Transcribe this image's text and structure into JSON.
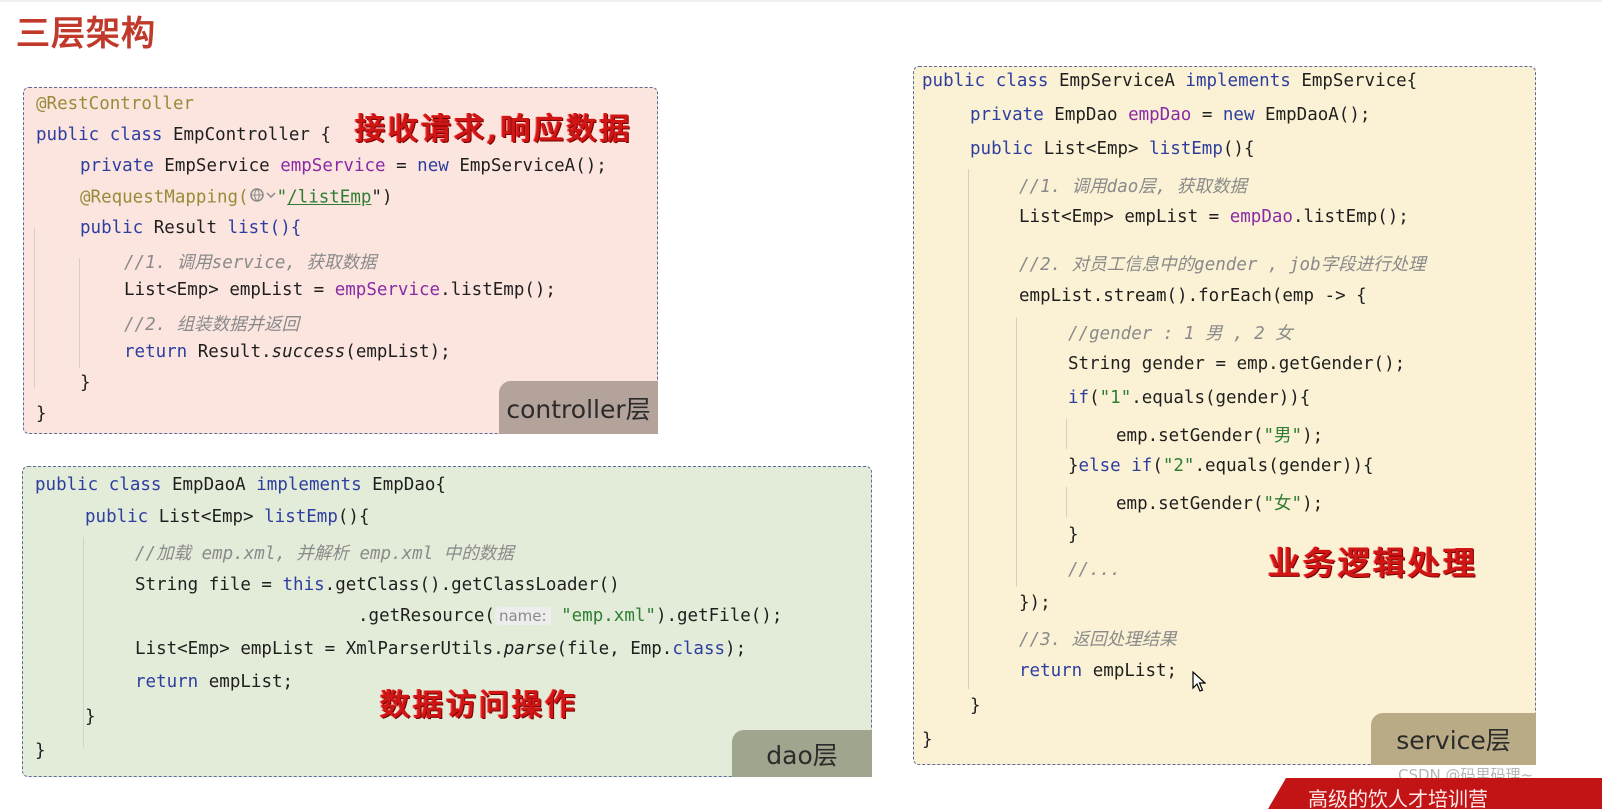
{
  "page": {
    "title": "三层架构"
  },
  "controller": {
    "annotation": "@RestController",
    "l1": {
      "a": "public class ",
      "b": "EmpController {"
    },
    "l2": {
      "a": "private ",
      "b": "EmpService ",
      "c": "empService",
      "d": " = ",
      "e": "new ",
      "f": "EmpServiceA();"
    },
    "l3": {
      "a": "@RequestMapping(",
      "icon": "globe-icon",
      "b": "\"",
      "c": "/listEmp",
      "d": "\")"
    },
    "l4": {
      "a": "public ",
      "b": "Result ",
      "c": "list(){"
    },
    "l5": "//1. 调用service, 获取数据",
    "l6": {
      "a": "List<Emp> empList = ",
      "b": "empService",
      "c": ".listEmp();"
    },
    "l7": "//2. 组装数据并返回",
    "l8": {
      "a": "return ",
      "b": "Result.",
      "c": "success",
      "d": "(empList);"
    },
    "l9": "}",
    "l10": "}",
    "tag": "controller层",
    "note": "接收请求,响应数据"
  },
  "dao": {
    "l1": {
      "a": "public class ",
      "b": "EmpDaoA ",
      "c": "implements ",
      "d": "EmpDao{"
    },
    "l2": {
      "a": "public ",
      "b": "List<Emp> ",
      "c": "listEmp",
      "d": "(){"
    },
    "l3": "//加载 emp.xml, 并解析 emp.xml 中的数据",
    "l4": {
      "a": "String file = ",
      "b": "this",
      "c": ".getClass().getClassLoader()"
    },
    "l5": {
      "a": ".getResource(",
      "hint": "name:",
      "b": "\"emp.xml\"",
      "c": ").getFile();"
    },
    "l6": {
      "a": "List<Emp> empList = XmlParserUtils.",
      "b": "parse",
      "c": "(file, Emp.",
      "d": "class",
      "e": ");"
    },
    "l7": {
      "a": "return ",
      "b": "empList;"
    },
    "l8": "}",
    "l9": "}",
    "tag": "dao层",
    "note": "数据访问操作"
  },
  "service": {
    "l1": {
      "a": "public class ",
      "b": "EmpServiceA ",
      "c": "implements ",
      "d": "EmpService{"
    },
    "l2": {
      "a": "private ",
      "b": "EmpDao ",
      "c": "empDao",
      "d": " = ",
      "e": "new ",
      "f": "EmpDaoA();"
    },
    "l3": {
      "a": "public ",
      "b": "List<Emp> ",
      "c": "listEmp",
      "d": "(){"
    },
    "l4": "//1. 调用dao层, 获取数据",
    "l5": {
      "a": "List<Emp> empList = ",
      "b": "empDao",
      "c": ".listEmp();"
    },
    "l6": "//2. 对员工信息中的gender , job字段进行处理",
    "l7": "empList.stream().forEach(emp -> {",
    "l8": "//gender : 1 男 , 2 女",
    "l9": "String gender = emp.getGender();",
    "l10": {
      "a": "if",
      "b": "(",
      "c": "\"1\"",
      "d": ".equals(gender)){"
    },
    "l11": {
      "a": "emp.setGender(",
      "b": "\"男\"",
      "c": ");"
    },
    "l12": {
      "a": "}",
      "b": "else if",
      "c": "(",
      "d": "\"2\"",
      "e": ".equals(gender)){"
    },
    "l13": {
      "a": "emp.setGender(",
      "b": "\"女\"",
      "c": ");"
    },
    "l14": "}",
    "l15": "//...",
    "l16": "});",
    "l17": "//3. 返回处理结果",
    "l18": {
      "a": "return ",
      "b": "empList;"
    },
    "l19": "}",
    "l20": "}",
    "tag": "service层",
    "note": "业务逻辑处理"
  },
  "overlay": {
    "watermark": "CSDN @码里码理~",
    "banner": "高级的饮人才培训营"
  },
  "colors": {
    "controller_bg": "#fbe5de",
    "dao_bg": "#e3ecd9",
    "service_bg": "#fbf2d5",
    "note_red": "#d01515",
    "title_red": "#c0392b"
  }
}
